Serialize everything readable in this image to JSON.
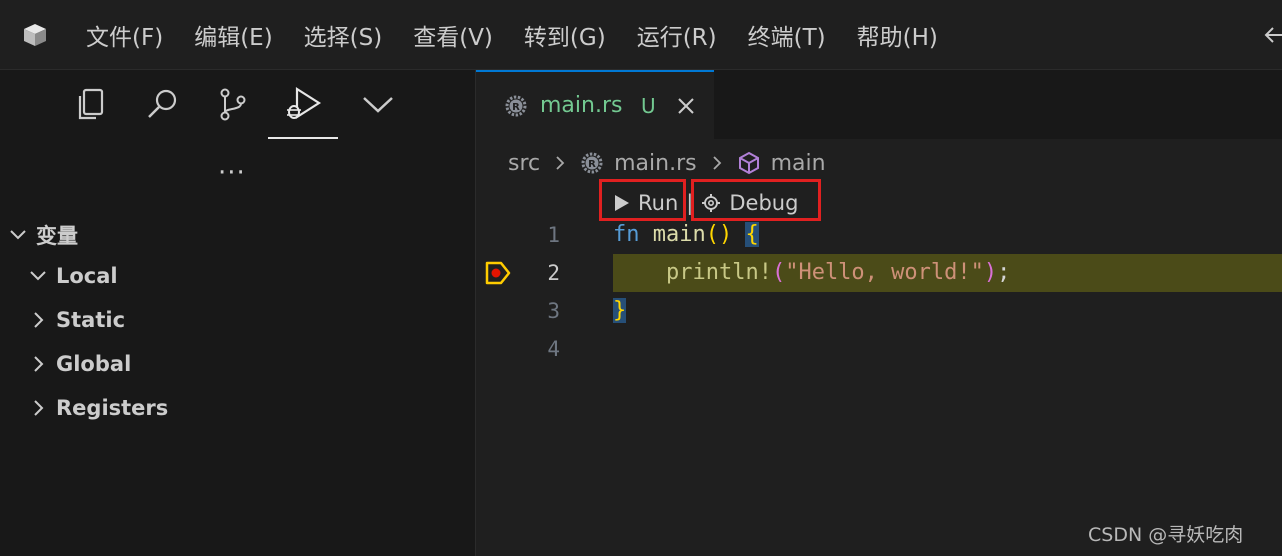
{
  "menubar": {
    "items": [
      "文件(F)",
      "编辑(E)",
      "选择(S)",
      "查看(V)",
      "转到(G)",
      "运行(R)",
      "终端(T)",
      "帮助(H)"
    ]
  },
  "activity_bar": {
    "icons": [
      "explorer-icon",
      "search-icon",
      "source-control-icon",
      "run-debug-icon",
      "chevron-down-icon"
    ],
    "more": "···"
  },
  "variables": {
    "header": "变量",
    "items": [
      {
        "label": "Local",
        "expanded": true
      },
      {
        "label": "Static",
        "expanded": false
      },
      {
        "label": "Global",
        "expanded": false
      },
      {
        "label": "Registers",
        "expanded": false
      }
    ]
  },
  "editor": {
    "tab": {
      "name": "main.rs",
      "status": "U"
    },
    "breadcrumb": {
      "folder": "src",
      "file": "main.rs",
      "symbol": "main"
    },
    "codelens": {
      "run": "Run",
      "separator": "|",
      "debug": "Debug"
    },
    "line_numbers": [
      "1",
      "2",
      "3",
      "4"
    ],
    "current_line": "2",
    "code": {
      "l1_kw": "fn",
      "l1_fn": "main",
      "l1_parens": "()",
      "l1_brace": "{",
      "l2_indent": "    ",
      "l2_macro": "println!",
      "l2_open": "(",
      "l2_str": "\"Hello, world!\"",
      "l2_close": ")",
      "l2_semi": ";",
      "l3_brace": "}"
    }
  },
  "colors": {
    "accent": "#0078d4",
    "untracked": "#73c991",
    "highlight_box": "#e02020",
    "debug_line": "#4b4b18"
  },
  "watermark": "CSDN @寻妖吃肉"
}
